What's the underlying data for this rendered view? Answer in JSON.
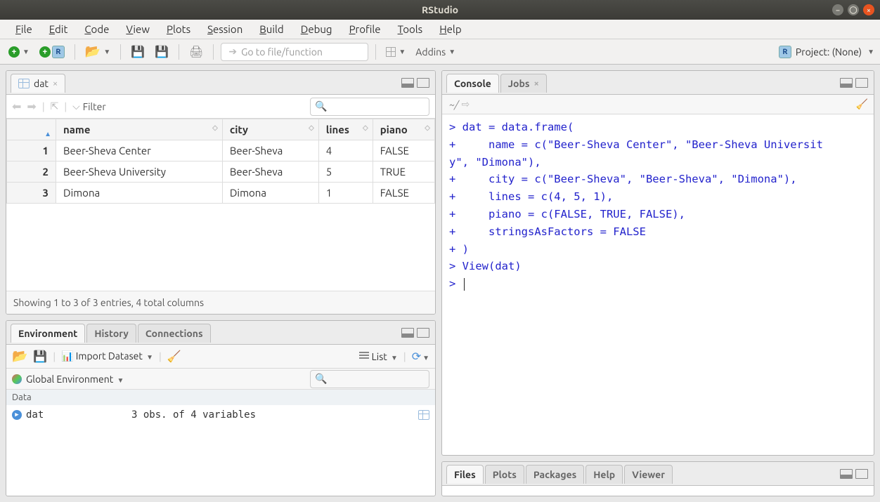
{
  "window": {
    "title": "RStudio"
  },
  "menubar": [
    "File",
    "Edit",
    "Code",
    "View",
    "Plots",
    "Session",
    "Build",
    "Debug",
    "Profile",
    "Tools",
    "Help"
  ],
  "toolbar": {
    "goto_placeholder": "Go to file/function",
    "addins_label": "Addins",
    "project_label": "Project: (None)"
  },
  "source": {
    "tab_label": "dat",
    "filter_label": "Filter",
    "columns": [
      "name",
      "city",
      "lines",
      "piano"
    ],
    "rows": [
      {
        "n": "1",
        "name": "Beer-Sheva Center",
        "city": "Beer-Sheva",
        "lines": "4",
        "piano": "FALSE"
      },
      {
        "n": "2",
        "name": "Beer-Sheva University",
        "city": "Beer-Sheva",
        "lines": "5",
        "piano": "TRUE"
      },
      {
        "n": "3",
        "name": "Dimona",
        "city": "Dimona",
        "lines": "1",
        "piano": "FALSE"
      }
    ],
    "footer": "Showing 1 to 3 of 3 entries, 4 total columns"
  },
  "env": {
    "tabs": [
      "Environment",
      "History",
      "Connections"
    ],
    "import_label": "Import Dataset",
    "view_label": "List",
    "scope_label": "Global Environment",
    "section": "Data",
    "item_name": "dat",
    "item_desc": "3 obs. of  4 variables"
  },
  "console": {
    "tabs": [
      "Console",
      "Jobs"
    ],
    "prompt_path": "~/",
    "text": "> dat = data.frame(\n+     name = c(\"Beer-Sheva Center\", \"Beer-Sheva Universit\ny\", \"Dimona\"),\n+     city = c(\"Beer-Sheva\", \"Beer-Sheva\", \"Dimona\"),\n+     lines = c(4, 5, 1),\n+     piano = c(FALSE, TRUE, FALSE),\n+     stringsAsFactors = FALSE\n+ )\n> View(dat)\n> "
  },
  "files": {
    "tabs": [
      "Files",
      "Plots",
      "Packages",
      "Help",
      "Viewer"
    ]
  }
}
